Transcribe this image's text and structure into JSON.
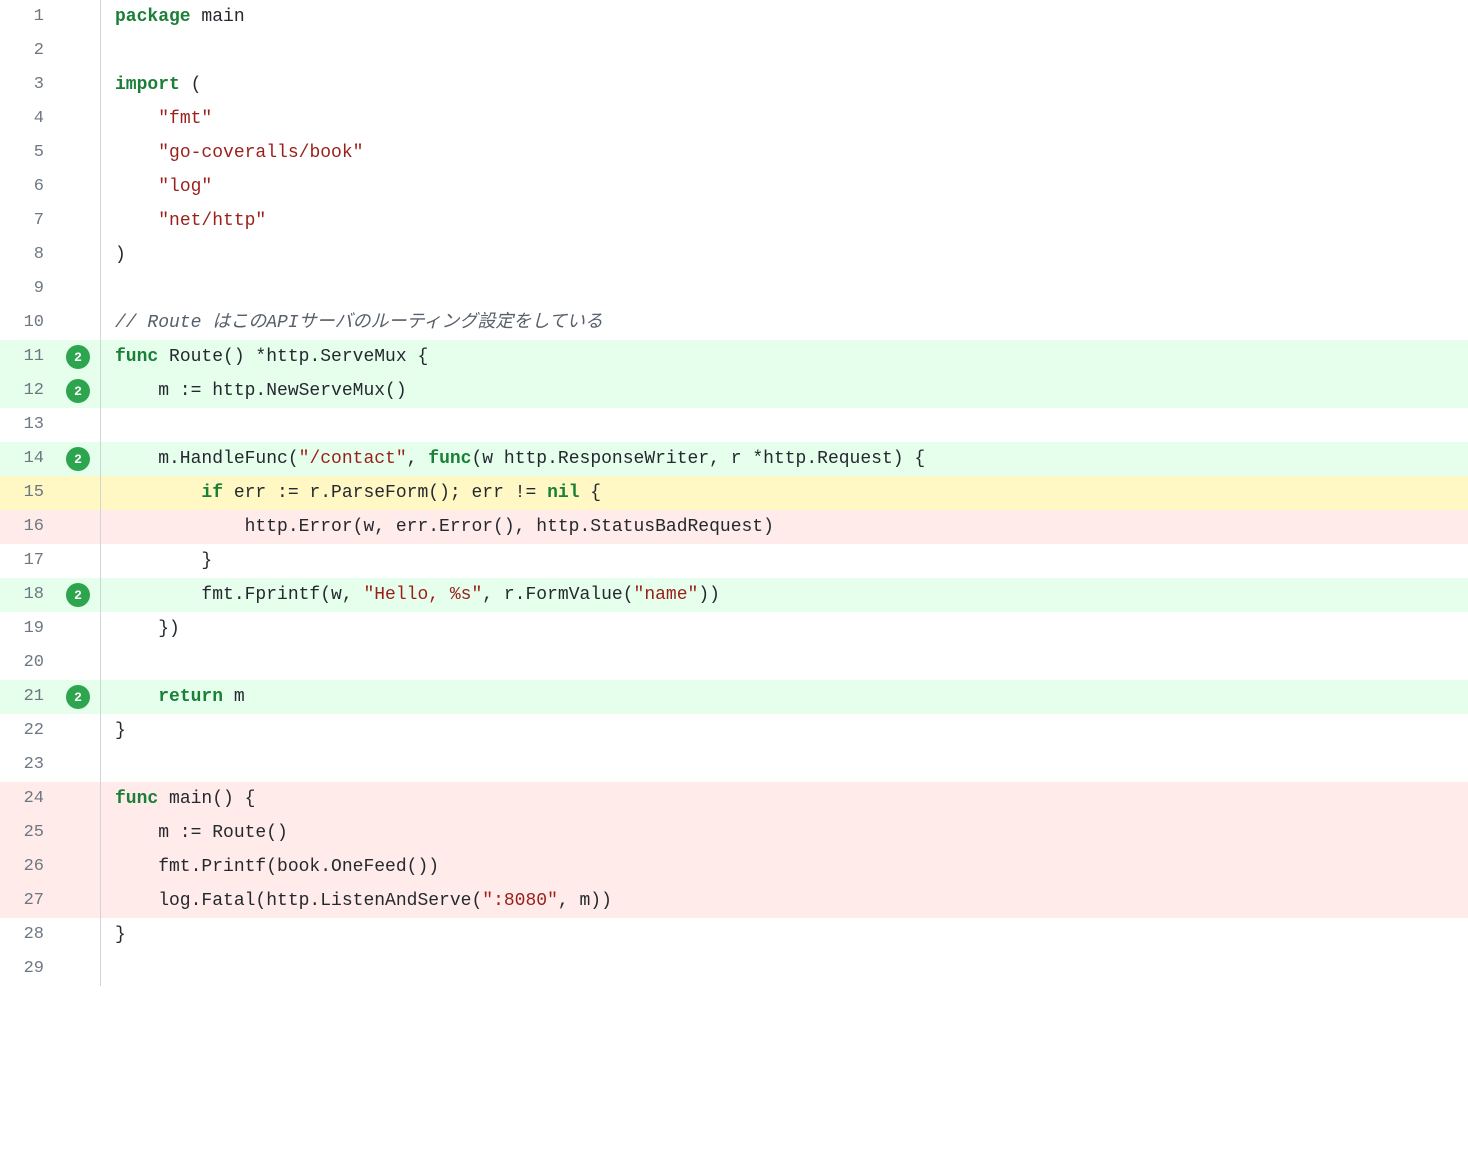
{
  "lines": [
    {
      "n": 1,
      "hits": null,
      "bg": "",
      "segs": [
        [
          "kw",
          "package"
        ],
        [
          "txt",
          " main"
        ]
      ]
    },
    {
      "n": 2,
      "hits": null,
      "bg": "",
      "segs": []
    },
    {
      "n": 3,
      "hits": null,
      "bg": "",
      "segs": [
        [
          "kw",
          "import"
        ],
        [
          "txt",
          " ("
        ]
      ]
    },
    {
      "n": 4,
      "hits": null,
      "bg": "",
      "segs": [
        [
          "txt",
          "    "
        ],
        [
          "str",
          "\"fmt\""
        ]
      ]
    },
    {
      "n": 5,
      "hits": null,
      "bg": "",
      "segs": [
        [
          "txt",
          "    "
        ],
        [
          "str",
          "\"go-coveralls/book\""
        ]
      ]
    },
    {
      "n": 6,
      "hits": null,
      "bg": "",
      "segs": [
        [
          "txt",
          "    "
        ],
        [
          "str",
          "\"log\""
        ]
      ]
    },
    {
      "n": 7,
      "hits": null,
      "bg": "",
      "segs": [
        [
          "txt",
          "    "
        ],
        [
          "str",
          "\"net/http\""
        ]
      ]
    },
    {
      "n": 8,
      "hits": null,
      "bg": "",
      "segs": [
        [
          "txt",
          ")"
        ]
      ]
    },
    {
      "n": 9,
      "hits": null,
      "bg": "",
      "segs": []
    },
    {
      "n": 10,
      "hits": null,
      "bg": "",
      "segs": [
        [
          "cmt",
          "// Route はこのAPIサーバのルーティング設定をしている"
        ]
      ]
    },
    {
      "n": 11,
      "hits": 2,
      "bg": "covered",
      "segs": [
        [
          "kw",
          "func"
        ],
        [
          "txt",
          " Route() *http.ServeMux {"
        ]
      ]
    },
    {
      "n": 12,
      "hits": 2,
      "bg": "covered",
      "segs": [
        [
          "txt",
          "    m := http.NewServeMux()"
        ]
      ]
    },
    {
      "n": 13,
      "hits": null,
      "bg": "",
      "segs": []
    },
    {
      "n": 14,
      "hits": 2,
      "bg": "covered",
      "segs": [
        [
          "txt",
          "    m.HandleFunc("
        ],
        [
          "str",
          "\"/contact\""
        ],
        [
          "txt",
          ", "
        ],
        [
          "kw",
          "func"
        ],
        [
          "txt",
          "(w http.ResponseWriter, r *http.Request) {"
        ]
      ]
    },
    {
      "n": 15,
      "hits": null,
      "bg": "partial",
      "segs": [
        [
          "txt",
          "        "
        ],
        [
          "kw",
          "if"
        ],
        [
          "txt",
          " err := r.ParseForm(); err != "
        ],
        [
          "kw",
          "nil"
        ],
        [
          "txt",
          " {"
        ]
      ]
    },
    {
      "n": 16,
      "hits": null,
      "bg": "miss",
      "segs": [
        [
          "txt",
          "            http.Error(w, err.Error(), http.StatusBadRequest)"
        ]
      ]
    },
    {
      "n": 17,
      "hits": null,
      "bg": "",
      "segs": [
        [
          "txt",
          "        }"
        ]
      ]
    },
    {
      "n": 18,
      "hits": 2,
      "bg": "covered",
      "segs": [
        [
          "txt",
          "        fmt.Fprintf(w, "
        ],
        [
          "str",
          "\"Hello, %s\""
        ],
        [
          "txt",
          ", r.FormValue("
        ],
        [
          "str",
          "\"name\""
        ],
        [
          "txt",
          "))"
        ]
      ]
    },
    {
      "n": 19,
      "hits": null,
      "bg": "",
      "segs": [
        [
          "txt",
          "    })"
        ]
      ]
    },
    {
      "n": 20,
      "hits": null,
      "bg": "",
      "segs": []
    },
    {
      "n": 21,
      "hits": 2,
      "bg": "covered",
      "segs": [
        [
          "txt",
          "    "
        ],
        [
          "kw",
          "return"
        ],
        [
          "txt",
          " m"
        ]
      ]
    },
    {
      "n": 22,
      "hits": null,
      "bg": "",
      "segs": [
        [
          "txt",
          "}"
        ]
      ]
    },
    {
      "n": 23,
      "hits": null,
      "bg": "",
      "segs": []
    },
    {
      "n": 24,
      "hits": null,
      "bg": "miss",
      "segs": [
        [
          "kw",
          "func"
        ],
        [
          "txt",
          " main() {"
        ]
      ]
    },
    {
      "n": 25,
      "hits": null,
      "bg": "miss",
      "segs": [
        [
          "txt",
          "    m := Route()"
        ]
      ]
    },
    {
      "n": 26,
      "hits": null,
      "bg": "miss",
      "segs": [
        [
          "txt",
          "    fmt.Printf(book.OneFeed())"
        ]
      ]
    },
    {
      "n": 27,
      "hits": null,
      "bg": "miss",
      "segs": [
        [
          "txt",
          "    log.Fatal(http.ListenAndServe("
        ],
        [
          "str",
          "\":8080\""
        ],
        [
          "txt",
          ", m))"
        ]
      ]
    },
    {
      "n": 28,
      "hits": null,
      "bg": "",
      "segs": [
        [
          "txt",
          "}"
        ]
      ]
    },
    {
      "n": 29,
      "hits": null,
      "bg": "",
      "segs": []
    }
  ]
}
